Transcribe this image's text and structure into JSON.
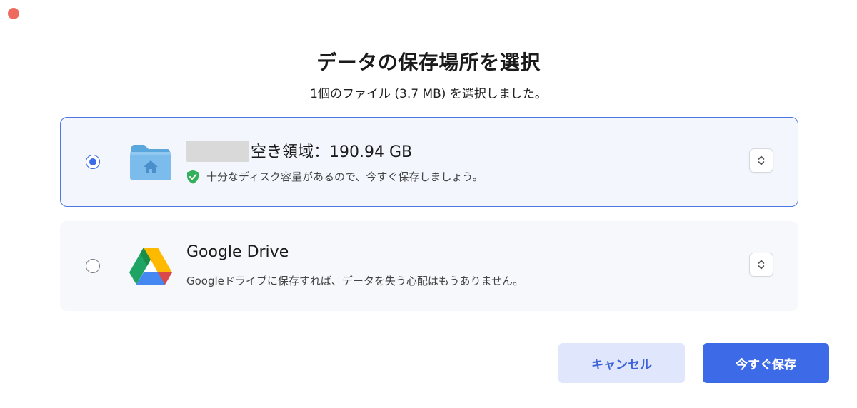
{
  "window": {
    "close_color": "#ee6a5f"
  },
  "dialog": {
    "title": "データの保存場所を選択",
    "subtitle": "1個のファイル (3.7 MB) を選択しました。"
  },
  "options": [
    {
      "selected": true,
      "icon": "home-folder-icon",
      "title_suffix": "空き領域：190.94 GB",
      "desc": "十分なディスク容量があるので、今すぐ保存しましょう。",
      "desc_icon": "shield-check-icon"
    },
    {
      "selected": false,
      "icon": "google-drive-icon",
      "title": "Google Drive",
      "desc": "Googleドライブに保存すれば、データを失う心配はもうありません。"
    }
  ],
  "buttons": {
    "cancel": "キャンセル",
    "save": "今すぐ保存"
  },
  "colors": {
    "accent": "#3d6ae6",
    "selected_bg": "#f3f6fd",
    "cancel_bg": "#e0e6fb"
  }
}
